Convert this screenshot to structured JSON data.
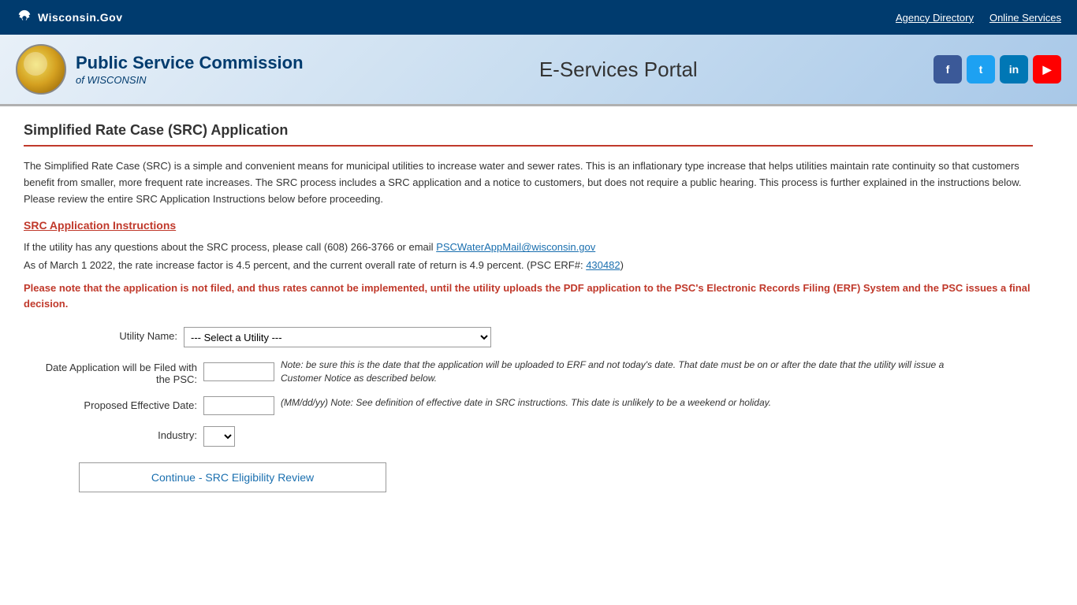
{
  "topbar": {
    "logo_text": "Wisconsin.Gov",
    "agency_directory": "Agency Directory",
    "online_services": "Online Services"
  },
  "header": {
    "agency_name": "Public Service Commission",
    "agency_sub": "of WISCONSIN",
    "portal_title": "E-Services Portal"
  },
  "social": {
    "fb": "f",
    "tw": "t",
    "li": "in",
    "yt": "▶"
  },
  "page": {
    "title": "Simplified Rate Case (SRC) Application",
    "intro": "The Simplified Rate Case (SRC) is a simple and convenient means for municipal utilities to increase water and sewer rates. This is an inflationary type increase that helps utilities maintain rate continuity so that customers benefit from smaller, more frequent rate increases. The SRC process includes a SRC application and a notice to customers, but does not require a public hearing. This process is further explained in the instructions below. Please review the entire SRC Application Instructions below before proceeding.",
    "instructions_link": "SRC Application Instructions",
    "contact_line": "If the utility has any questions about the SRC process, please call (608) 266-3766 or email",
    "contact_email": "PSCWaterAppMail@wisconsin.gov",
    "rate_line": "As of March 1 2022, the rate increase factor is 4.5 percent, and the current overall rate of return is 4.9 percent. (PSC ERF#:",
    "erf_number": "430482",
    "warning": "Please note that the application is not filed, and thus rates cannot be implemented, until the utility uploads the PDF application to the PSC's Electronic Records Filing (ERF) System and the PSC issues a final decision.",
    "form": {
      "utility_label": "Utility Name:",
      "utility_default": "--- Select a Utility ---",
      "date_filed_label": "Date Application will be Filed with",
      "date_filed_label2": "the PSC:",
      "date_format": "(MM/dd/yy)",
      "date_filed_note": "Note: be sure this is the date that the application will be uploaded to ERF and not today's date. That date must be on or after the date that the utility will issue a Customer Notice as described below.",
      "effective_date_label": "Proposed Effective Date:",
      "effective_date_note": "(MM/dd/yy) Note: See definition of effective date in SRC instructions. This date is unlikely to be a weekend or holiday.",
      "industry_label": "Industry:",
      "continue_btn": "Continue - SRC Eligibility Review"
    }
  }
}
